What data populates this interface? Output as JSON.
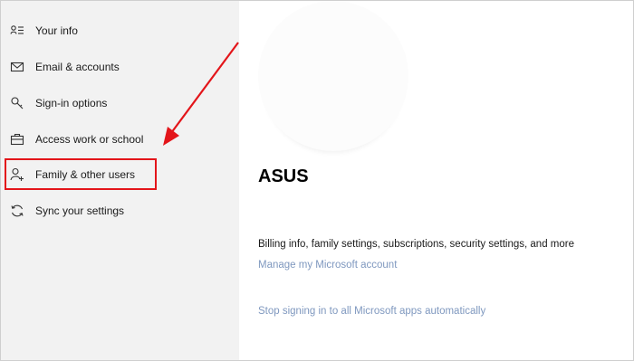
{
  "sidebar": {
    "items": [
      {
        "label": "Your info",
        "icon": "person-list-icon"
      },
      {
        "label": "Email & accounts",
        "icon": "mail-icon"
      },
      {
        "label": "Sign-in options",
        "icon": "key-icon"
      },
      {
        "label": "Access work or school",
        "icon": "briefcase-icon"
      },
      {
        "label": "Family & other users",
        "icon": "person-add-icon"
      },
      {
        "label": "Sync your settings",
        "icon": "sync-icon"
      }
    ]
  },
  "account": {
    "name": "ASUS",
    "billing_text": "Billing info, family settings, subscriptions, security settings, and more",
    "manage_link": "Manage my Microsoft account",
    "stop_signing_link": "Stop signing in to all Microsoft apps automatically"
  },
  "annotation": {
    "highlight_color": "#e3151a",
    "highlighted_item": "Family & other users"
  },
  "colors": {
    "sidebar_bg": "#f2f2f2",
    "link": "#7f98bf"
  }
}
